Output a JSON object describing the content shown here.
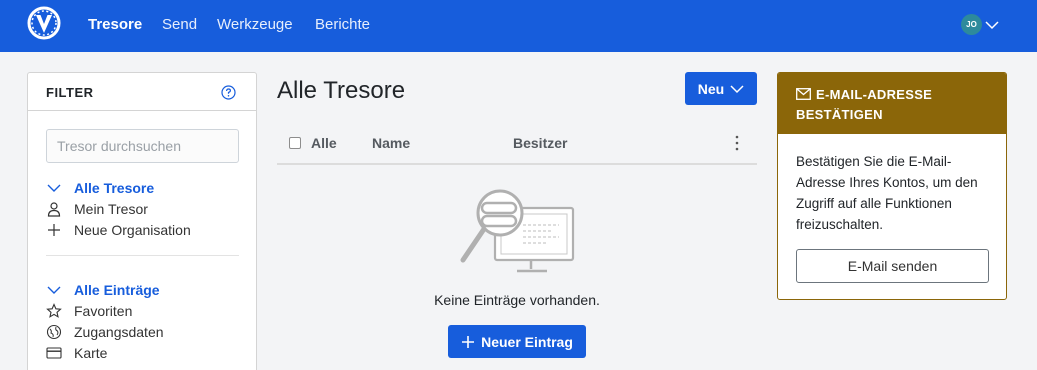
{
  "nav": {
    "items": [
      {
        "label": "Tresore",
        "active": true
      },
      {
        "label": "Send",
        "active": false
      },
      {
        "label": "Werkzeuge",
        "active": false
      },
      {
        "label": "Berichte",
        "active": false
      }
    ],
    "avatar_initials": "JO",
    "brand_color": "#175ddc"
  },
  "filter": {
    "title": "FILTER",
    "search_placeholder": "Tresor durchsuchen",
    "vaults_header": "Alle Tresore",
    "vaults": [
      "Mein Tresor",
      "Neue Organisation"
    ],
    "items_header": "Alle Einträge",
    "items": [
      "Favoriten",
      "Zugangsdaten",
      "Karte"
    ]
  },
  "main": {
    "title": "Alle Tresore",
    "new_button": "Neu",
    "columns": {
      "all": "Alle",
      "name": "Name",
      "owner": "Besitzer"
    },
    "empty_text": "Keine Einträge vorhanden.",
    "new_entry_button": "Neuer Eintrag"
  },
  "verify": {
    "title": "E-MAIL-ADRESSE BESTÄTIGEN",
    "body": "Bestätigen Sie die E-Mail-Adresse Ihres Kontos, um den Zugriff auf alle Funktionen freizuschalten.",
    "button": "E-Mail senden",
    "accent_color": "#8b6609"
  }
}
